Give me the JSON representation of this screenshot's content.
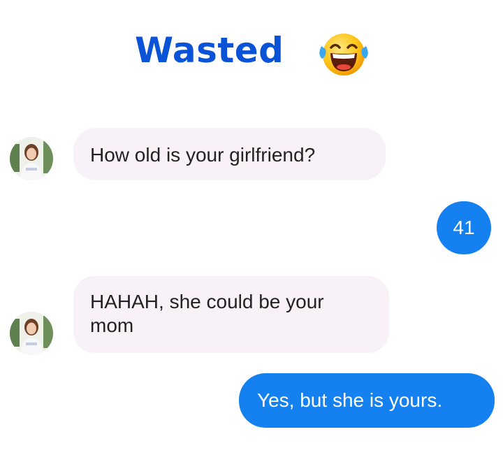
{
  "header": {
    "title": "Wasted",
    "emoji_icon": "face-with-tears-of-joy-icon"
  },
  "conversation": {
    "messages": [
      {
        "sender": "contact",
        "text": "How old is your girlfriend?"
      },
      {
        "sender": "me",
        "text": "41"
      },
      {
        "sender": "contact",
        "text": "HAHAH, she could be your mom"
      },
      {
        "sender": "me",
        "text": "Yes, but she is yours."
      }
    ]
  },
  "colors": {
    "title": "#0a52d6",
    "outgoing_bubble": "#1580f0",
    "incoming_bubble": "#f8f1f7"
  }
}
